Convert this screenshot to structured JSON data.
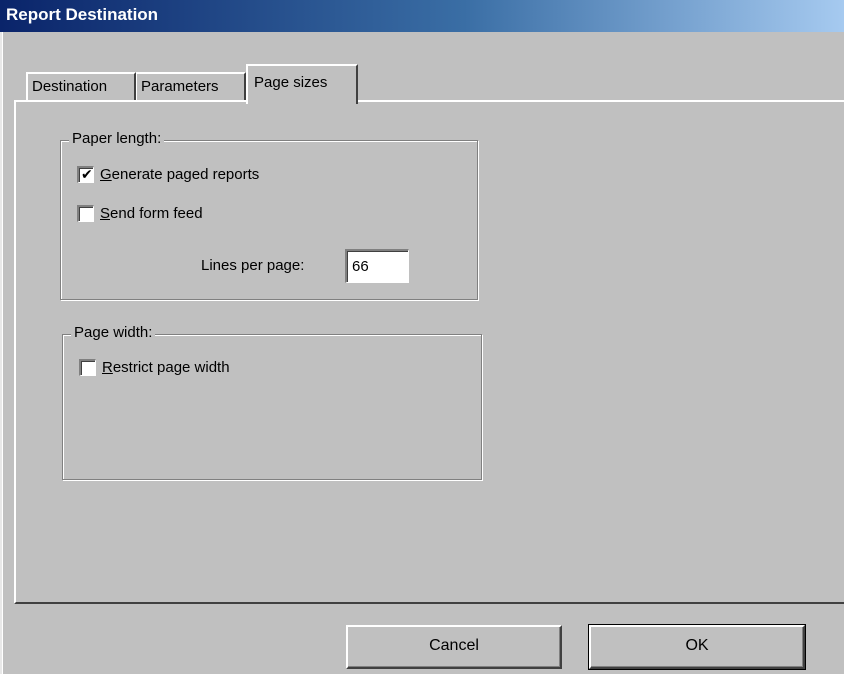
{
  "window": {
    "title": "Report Destination"
  },
  "tabs": [
    {
      "label": "Destination"
    },
    {
      "label": "Parameters"
    },
    {
      "label": "Page sizes",
      "active": true
    }
  ],
  "paper_length": {
    "legend": "Paper length:",
    "generate_paged": {
      "first": "G",
      "rest": "enerate paged reports",
      "checked": true
    },
    "send_form_feed": {
      "first": "S",
      "rest": "end form feed",
      "checked": false
    },
    "lines_per_page": {
      "label": "Lines per page:",
      "value": "66"
    }
  },
  "page_width": {
    "legend": "Page width:",
    "restrict": {
      "first": "R",
      "rest": "estrict page width",
      "checked": false
    }
  },
  "buttons": {
    "cancel": "Cancel",
    "ok": "OK"
  }
}
